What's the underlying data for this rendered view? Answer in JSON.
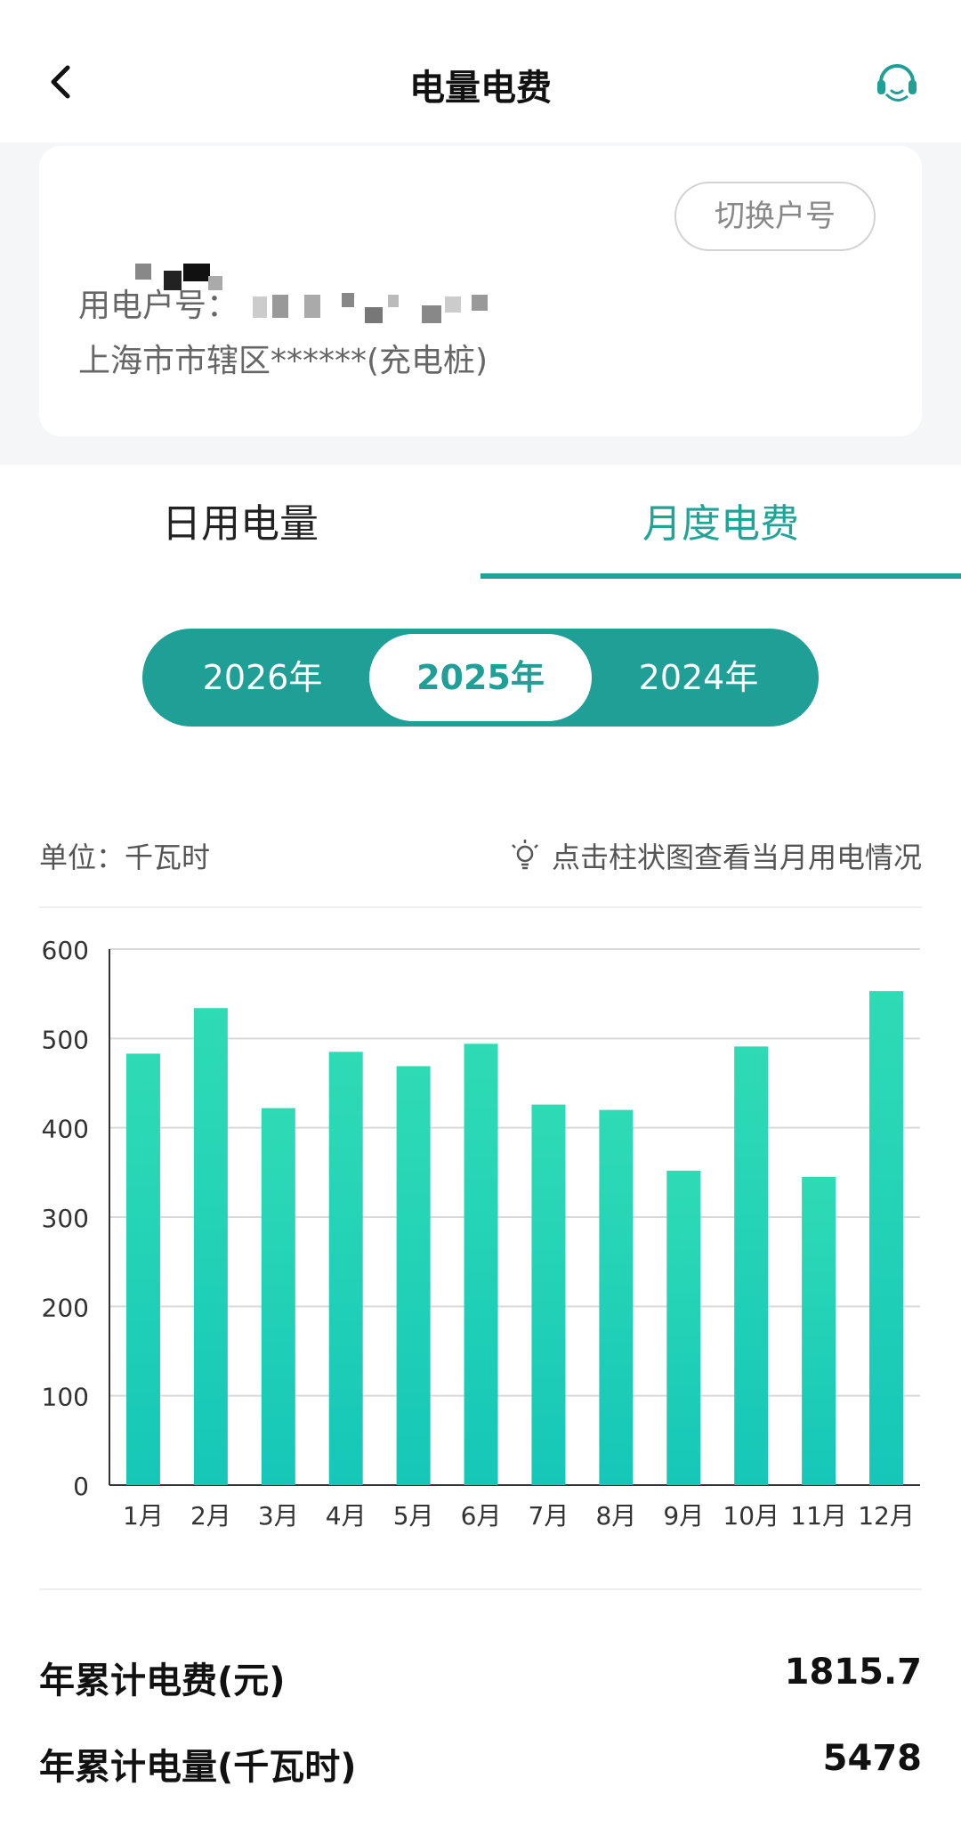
{
  "header": {
    "title": "电量电费"
  },
  "account": {
    "switch_label": "切换户号",
    "number_label": "用电户号：",
    "address": "上海市市辖区******(充电桩)"
  },
  "tabs": [
    {
      "label": "日用电量",
      "active": false
    },
    {
      "label": "月度电费",
      "active": true
    }
  ],
  "years": [
    {
      "label": "2026年",
      "selected": false
    },
    {
      "label": "2025年",
      "selected": true
    },
    {
      "label": "2024年",
      "selected": false
    }
  ],
  "unit_label": "单位：千瓦时",
  "tip": {
    "icon": "lightbulb-icon",
    "text": "点击柱状图查看当月用电情况"
  },
  "chart_data": {
    "type": "bar",
    "categories": [
      "1月",
      "2月",
      "3月",
      "4月",
      "5月",
      "6月",
      "7月",
      "8月",
      "9月",
      "10月",
      "11月",
      "12月"
    ],
    "values": [
      483,
      534,
      422,
      485,
      469,
      494,
      426,
      420,
      352,
      491,
      345,
      553
    ],
    "ylim": [
      0,
      600
    ],
    "yticks": [
      "0",
      "100",
      "200",
      "300",
      "400",
      "500",
      "600"
    ],
    "grid": true,
    "bar_color_top": "#2fdbb5",
    "bar_color_bottom": "#16c7b8"
  },
  "totals": [
    {
      "label": "年累计电费(元)",
      "value": "1815.7"
    },
    {
      "label": "年累计电量(千瓦时)",
      "value": "5478"
    }
  ],
  "colors": {
    "accent": "#21a497",
    "segment": "#1f9f96",
    "bar": "#20d0b6"
  }
}
